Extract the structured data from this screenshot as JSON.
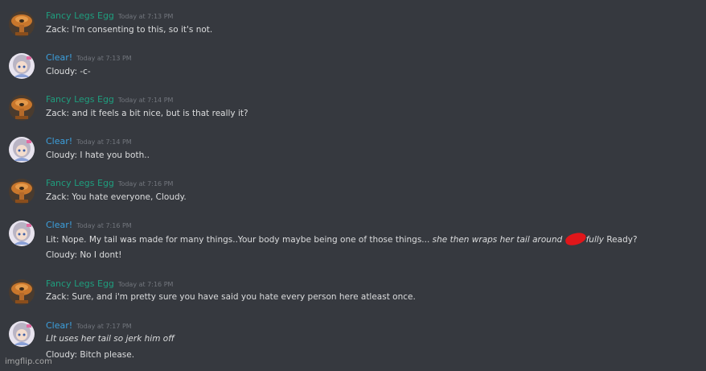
{
  "messages": [
    {
      "author": "Fancy Legs Egg",
      "timestamp": "Today at 7:13 PM",
      "lines": [
        "Zack: I'm consenting to this, so it's not."
      ]
    },
    {
      "author": "Clear!",
      "timestamp": "Today at 7:13 PM",
      "lines": [
        "Cloudy: -c-"
      ]
    },
    {
      "author": "Fancy Legs Egg",
      "timestamp": "Today at 7:14 PM",
      "lines": [
        "Zack: and it feels a bit nice, but is that really it?"
      ]
    },
    {
      "author": "Clear!",
      "timestamp": "Today at 7:14 PM",
      "lines": [
        "Cloudy: I hate you both.."
      ]
    },
    {
      "author": "Fancy Legs Egg",
      "timestamp": "Today at 7:16 PM",
      "lines": [
        "Zack: You hate everyone, Cloudy."
      ]
    },
    {
      "author": "Clear!",
      "timestamp": "Today at 7:16 PM",
      "line1_text": "Lit: Nope. My tail was made for many things..Your body maybe being one of those things... ",
      "line1_italic_a": "she then wraps her tail around ",
      "line1_italic_b": "fully",
      "line1_end": " Ready?",
      "line2": "Cloudy: No I dont!"
    },
    {
      "author": "Fancy Legs Egg",
      "timestamp": "Today at 7:16 PM",
      "lines": [
        "Zack: Sure, and i'm pretty sure you have said you hate every person here atleast once."
      ]
    },
    {
      "author": "Clear!",
      "timestamp": "Today at 7:17 PM",
      "italic_line": "LIt uses her tail so jerk him off",
      "lines": [
        "Cloudy: Bitch please."
      ]
    }
  ],
  "watermark": "imgflip.com",
  "colors": {
    "background": "#36393f",
    "author_teal": "#1f9e7e",
    "author_blue": "#3c9fdc",
    "text": "#dcddde",
    "timestamp": "#72767d",
    "redaction": "#e0161a"
  },
  "icons": {
    "egg_avatar": "mushroom-avatar-icon",
    "clear_avatar": "anime-girl-avatar-icon"
  }
}
